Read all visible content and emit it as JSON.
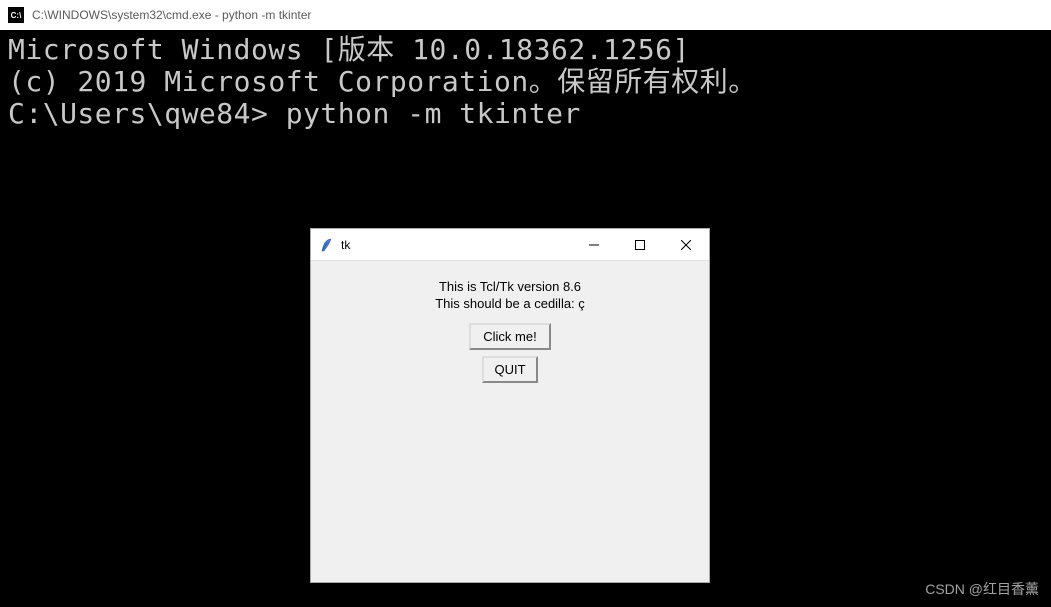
{
  "cmd": {
    "titlebar_icon_text": "C:\\",
    "titlebar_text": "C:\\WINDOWS\\system32\\cmd.exe - python  -m tkinter",
    "line1": "Microsoft Windows [版本 10.0.18362.1256]",
    "line2": "(c) 2019 Microsoft Corporation。保留所有权利。",
    "line3": "",
    "prompt": "C:\\Users\\qwe84> python -m tkinter"
  },
  "tk": {
    "title": "tk",
    "label_line1": "This is Tcl/Tk version 8.6",
    "label_line2": "This should be a cedilla: ç",
    "button_click": "Click me!",
    "button_quit": "QUIT"
  },
  "watermark": "CSDN @红目香薰"
}
